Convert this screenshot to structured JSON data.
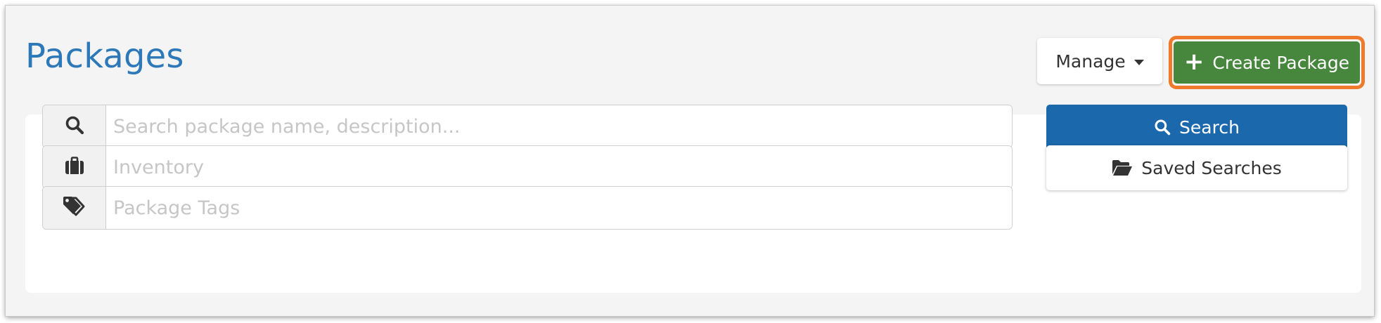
{
  "header": {
    "title": "Packages",
    "manage_label": "Manage",
    "create_label": "Create Package"
  },
  "filters": {
    "search": {
      "placeholder": "Search package name, description...",
      "value": ""
    },
    "inventory": {
      "placeholder": "Inventory",
      "value": ""
    },
    "tags": {
      "placeholder": "Package Tags",
      "value": ""
    }
  },
  "actions": {
    "search_label": "Search",
    "saved_searches_label": "Saved Searches"
  },
  "icons": {
    "search": "search-icon",
    "inventory": "briefcase-icon",
    "tags": "tags-icon",
    "folder": "folder-open-icon",
    "plus": "plus-icon",
    "caret": "caret-down-icon"
  },
  "colors": {
    "title": "#2c78b8",
    "create_button": "#47873d",
    "create_highlight": "#ef7a2b",
    "search_button": "#1c68ad"
  }
}
